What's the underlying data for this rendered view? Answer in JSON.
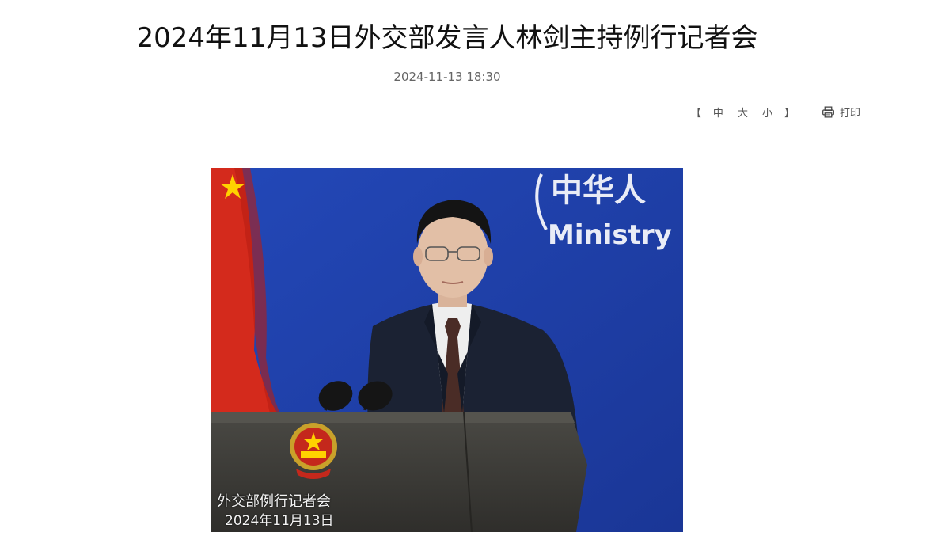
{
  "article": {
    "title": "2024年11月13日外交部发言人林剑主持例行记者会",
    "date": "2024-11-13 18:30"
  },
  "toolbar": {
    "font_size": {
      "open_bracket": "【",
      "options": [
        "中",
        "大",
        "小"
      ],
      "close_bracket": "】"
    },
    "print_label": "打印",
    "print_icon": "printer-icon"
  },
  "photo": {
    "backdrop_text_cn": "中华人",
    "backdrop_text_en": "Ministry",
    "caption_line1": "外交部例行记者会",
    "caption_line2": "2024年11月13日"
  },
  "colors": {
    "divider": "#b9d3e6",
    "backdrop_blue": "#1c3fa8",
    "flag_red": "#d42a1c",
    "podium": "#3d3c38"
  }
}
